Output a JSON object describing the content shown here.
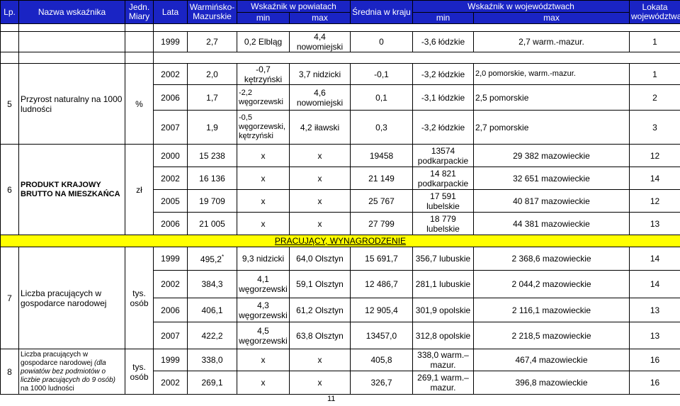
{
  "header": {
    "lp": "Lp.",
    "nazwa": "Nazwa wskaźnika",
    "jedn": "Jedn. Miary",
    "lata": "Lata",
    "warm": "Warmińsko-Mazurskie",
    "powiaty": "Wskaźnik w powiatach",
    "min": "min",
    "max": "max",
    "srednia": "Średnia w kraju",
    "woj": "Wskaźnik w województwach",
    "lokata": "Lokata województwa"
  },
  "top_row": {
    "year": "1999",
    "wm": "2,7",
    "pmin": "0,2 Elbląg",
    "pmax": "4,4 nowomiejski",
    "avg": "0",
    "wmin": "-3,6 łódzkie",
    "wmax": "2,7 warm.-mazur.",
    "rank": "1"
  },
  "ind5": {
    "lp": "5",
    "name": "Przyrost naturalny na 1000 ludności",
    "unit": "%",
    "rows": [
      {
        "year": "2002",
        "wm": "2,0",
        "pmin": "-0,7 kętrzyński",
        "pmax": "3,7 nidzicki",
        "avg": "-0,1",
        "wmin": "-3,2 łódzkie",
        "wmax": "2,0 pomorskie, warm.-mazur.",
        "rank": "1"
      },
      {
        "year": "2006",
        "wm": "1,7",
        "pmin": "-2,2 węgorzewski",
        "pmax": "4,6 nowomiejski",
        "avg": "0,1",
        "wmin": "-3,1 łódzkie",
        "wmax": "2,5 pomorskie",
        "rank": "2"
      },
      {
        "year": "2007",
        "wm": "1,9",
        "pmin": "-0,5 węgorzewski, kętrzyński",
        "pmax": "4,2 iławski",
        "avg": "0,3",
        "wmin": "-3,2 łódzkie",
        "wmax": "2,7 pomorskie",
        "rank": "3"
      }
    ]
  },
  "ind6": {
    "lp": "6",
    "name": "PRODUKT KRAJOWY BRUTTO NA MIESZKAŃCA",
    "unit": "zł",
    "rows": [
      {
        "year": "2000",
        "wm": "15 238",
        "pmin": "x",
        "pmax": "x",
        "avg": "19458",
        "wmin": "13574 podkarpackie",
        "wmax": "29 382 mazowieckie",
        "rank": "12"
      },
      {
        "year": "2002",
        "wm": "16 136",
        "pmin": "x",
        "pmax": "x",
        "avg": "21 149",
        "wmin": "14 821 podkarpackie",
        "wmax": "32 651 mazowieckie",
        "rank": "14"
      },
      {
        "year": "2005",
        "wm": "19 709",
        "pmin": "x",
        "pmax": "x",
        "avg": "25 767",
        "wmin": "17 591 lubelskie",
        "wmax": "40 817 mazowieckie",
        "rank": "12"
      },
      {
        "year": "2006",
        "wm": "21 005",
        "pmin": "x",
        "pmax": "x",
        "avg": "27 799",
        "wmin": "18 779 lubelskie",
        "wmax": "44 381 mazowieckie",
        "rank": "13"
      }
    ]
  },
  "band": "PRACUJĄCY, WYNAGRODZENIE",
  "ind7": {
    "lp": "7",
    "name": "Liczba pracujących w gospodarce narodowej",
    "unit": "tys. osób",
    "rows": [
      {
        "year": "1999",
        "wm": "495,2",
        "wm_sup": "*",
        "pmin": "9,3 nidzicki",
        "pmax": "64,0 Olsztyn",
        "avg": "15 691,7",
        "wmin": "356,7 lubuskie",
        "wmax": "2 368,6 mazowieckie",
        "rank": "14"
      },
      {
        "year": "2002",
        "wm": "384,3",
        "pmin": "4,1 węgorzewski",
        "pmax": "59,1 Olsztyn",
        "avg": "12 486,7",
        "wmin": "281,1 lubuskie",
        "wmax": "2 044,2 mazowieckie",
        "rank": "14"
      },
      {
        "year": "2006",
        "wm": "406,1",
        "pmin": "4,3 węgorzewski",
        "pmax": "61,2 Olsztyn",
        "avg": "12 905,4",
        "wmin": "301,9 opolskie",
        "wmax": "2 116,1 mazowieckie",
        "rank": "13"
      },
      {
        "year": "2007",
        "wm": "422,2",
        "pmin": "4,5 węgorzewski",
        "pmax": "63,8 Olsztyn",
        "avg": "13457,0",
        "wmin": "312,8 opolskie",
        "wmax": "2 218,5 mazowieckie",
        "rank": "13"
      }
    ]
  },
  "ind8": {
    "lp": "8",
    "name_a": "Liczba pracujących w gospodarce narodowej ",
    "name_b": "(dla powiatów bez podmiotów o liczbie pracujących do 9 osób)",
    "name_c": " na 1000 ludności",
    "unit": "tys. osób",
    "rows": [
      {
        "year": "1999",
        "wm": "338,0",
        "pmin": "x",
        "pmax": "x",
        "avg": "405,8",
        "wmin": "338,0 warm.– mazur.",
        "wmax": "467,4 mazowieckie",
        "rank": "16"
      },
      {
        "year": "2002",
        "wm": "269,1",
        "pmin": "x",
        "pmax": "x",
        "avg": "326,7",
        "wmin": "269,1 warm.– mazur.",
        "wmax": "396,8 mazowieckie",
        "rank": "16"
      }
    ]
  },
  "page_number": "11"
}
